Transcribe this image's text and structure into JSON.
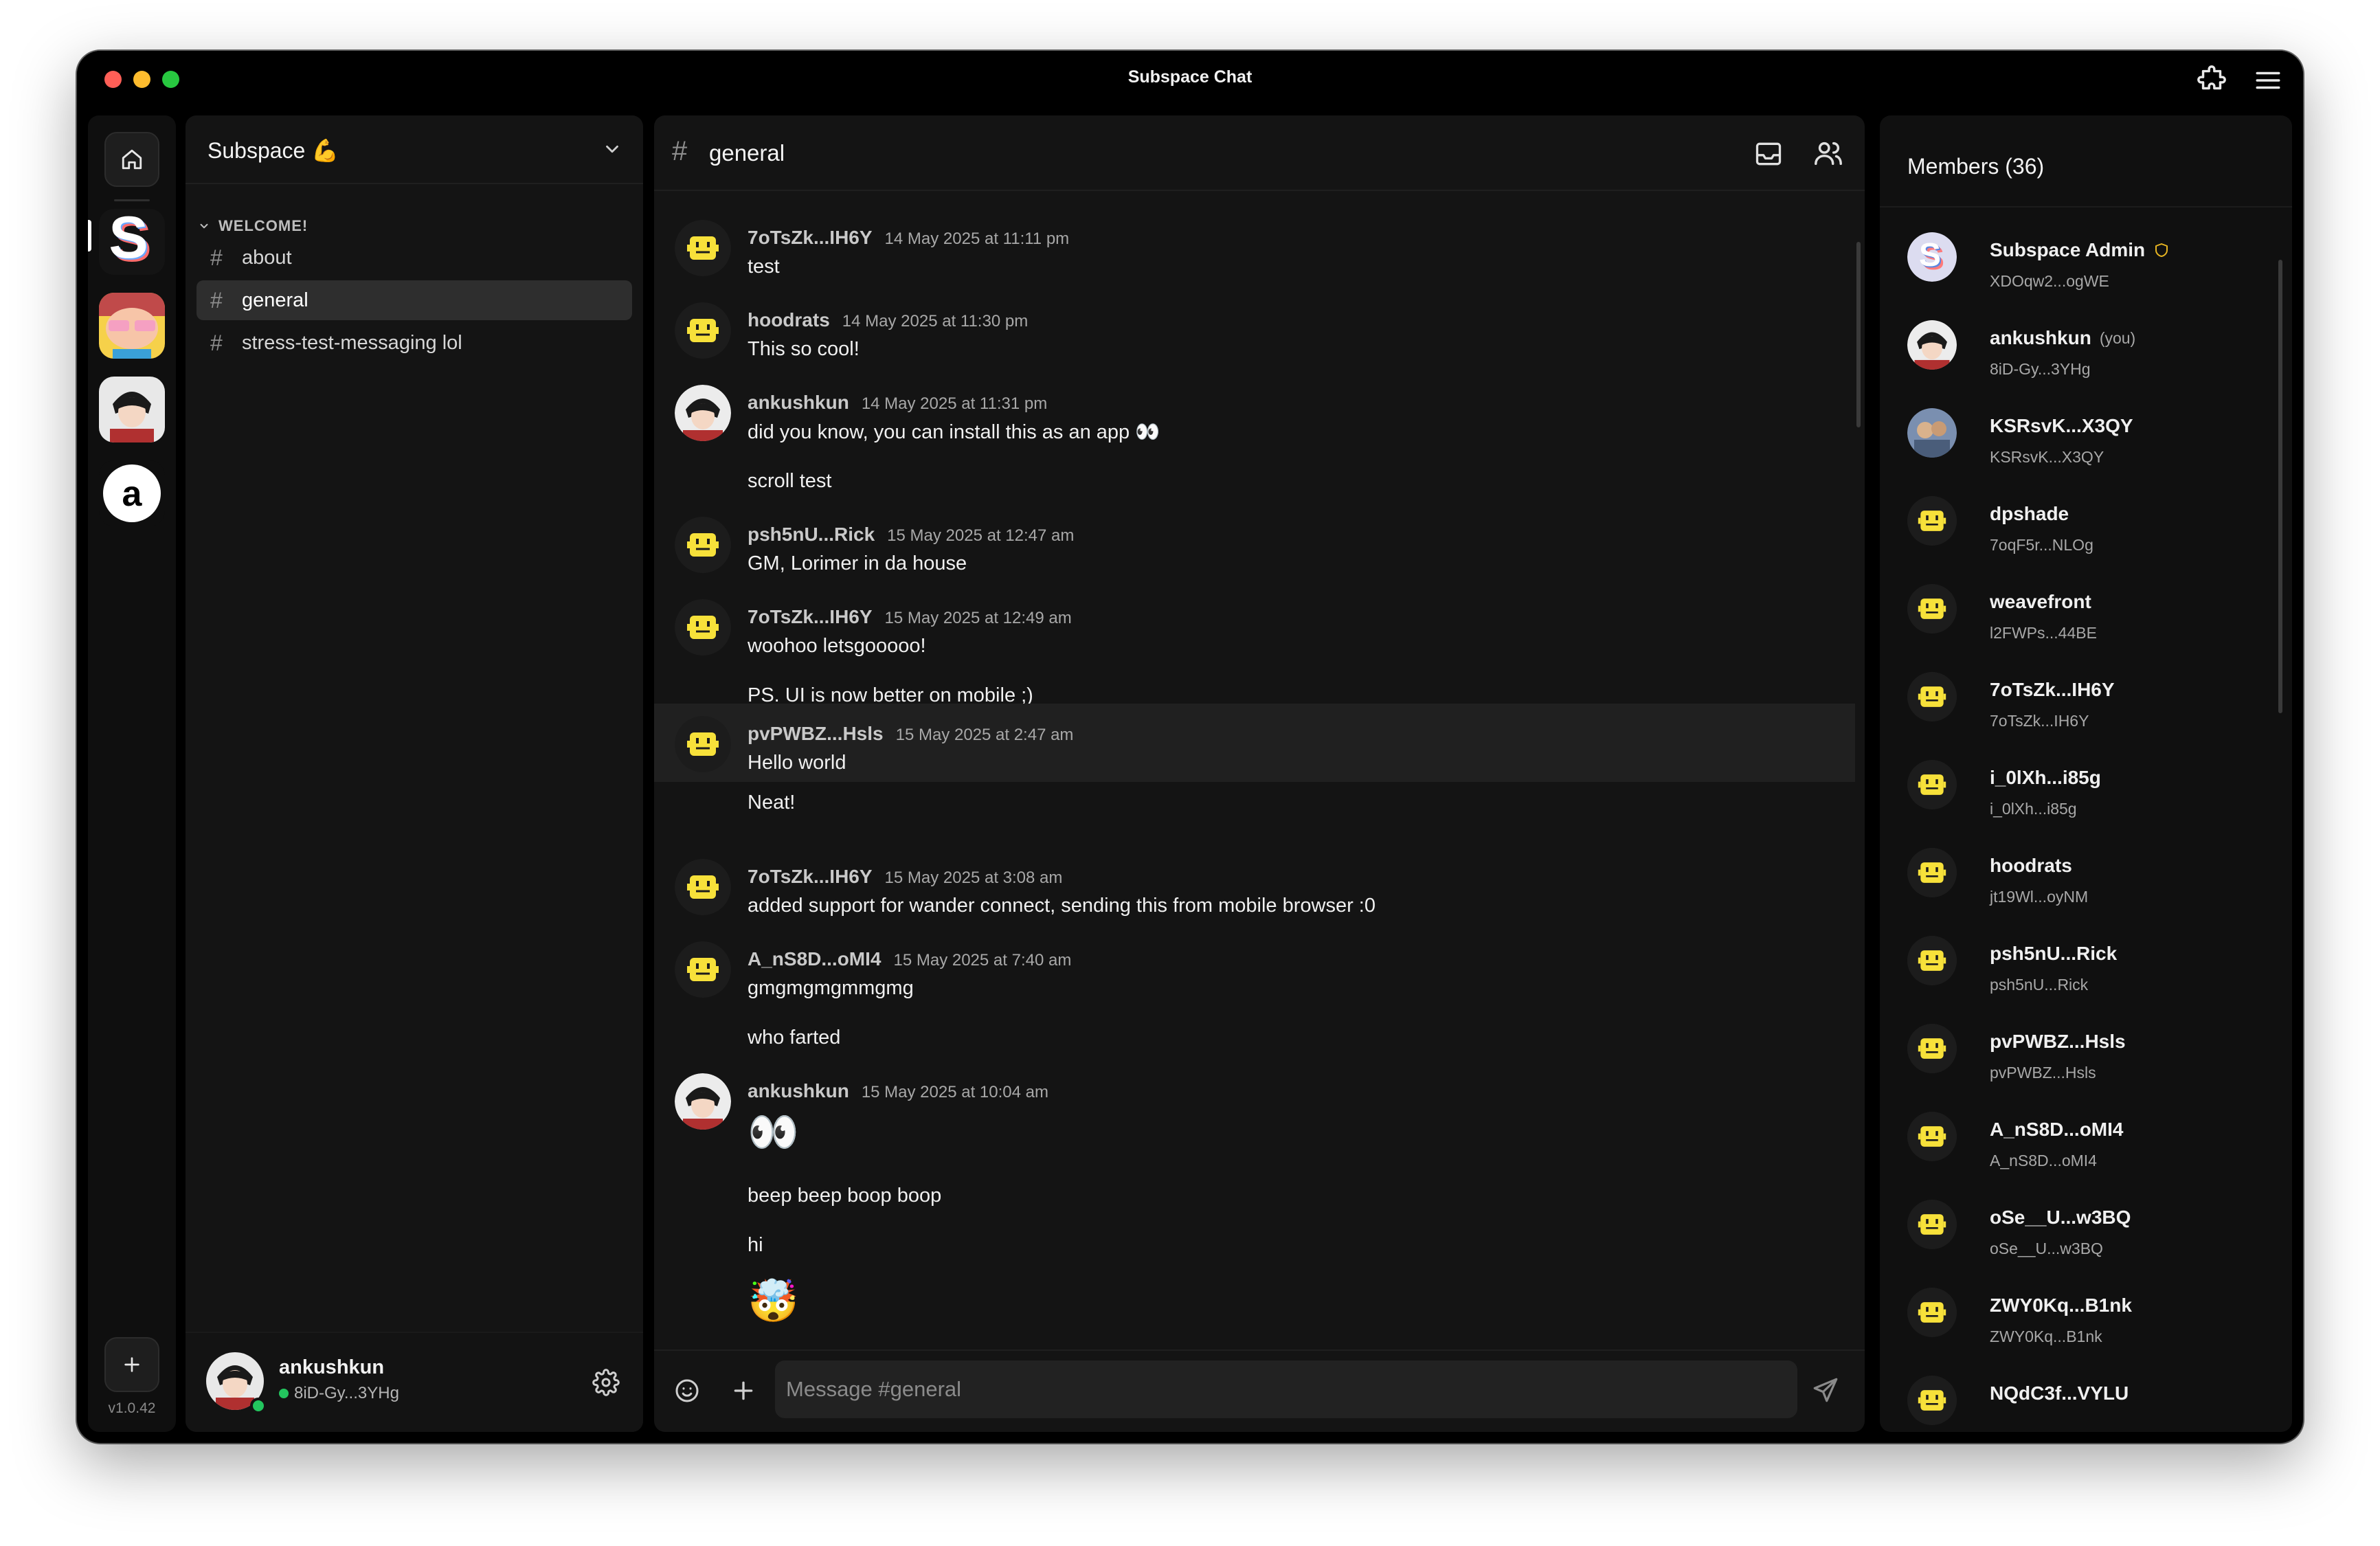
{
  "window": {
    "title": "Subspace Chat"
  },
  "rail": {
    "version": "v1.0.42"
  },
  "server": {
    "name": "Subspace 💪",
    "category": "WELCOME!",
    "channels": [
      {
        "label": "about",
        "active": false
      },
      {
        "label": "general",
        "active": true
      },
      {
        "label": "stress-test-messaging lol",
        "active": false
      }
    ]
  },
  "current_user": {
    "name": "ankushkun",
    "id": "8iD-Gy...3YHg",
    "status_color": "#23c55e"
  },
  "chat": {
    "channel": "general",
    "composer_placeholder": "Message #general",
    "messages": [
      {
        "author": "7oTsZk...IH6Y",
        "time": "14 May 2025 at 11:11 pm",
        "lines": [
          "test"
        ],
        "avatar": "bot-icon"
      },
      {
        "author": "hoodrats",
        "time": "14 May 2025 at 11:30 pm",
        "lines": [
          "This so cool!"
        ],
        "avatar": "bot-icon"
      },
      {
        "author": "ankushkun",
        "time": "14 May 2025 at 11:31 pm",
        "lines": [
          "did you know, you can install this as an app 👀",
          "scroll test"
        ],
        "avatar": "anime-avatar"
      },
      {
        "author": "psh5nU...Rick",
        "time": "15 May 2025 at 12:47 am",
        "lines": [
          "GM, Lorimer in da house"
        ],
        "avatar": "bot-icon"
      },
      {
        "author": "7oTsZk...IH6Y",
        "time": "15 May 2025 at 12:49 am",
        "lines": [
          "woohoo letsgooooo!",
          "PS. UI is now better on mobile ;)"
        ],
        "avatar": "bot-icon"
      },
      {
        "author": "pvPWBZ...Hsls",
        "time": "15 May 2025 at 2:47 am",
        "lines": [
          "Hello world",
          "Neat!"
        ],
        "avatar": "bot-icon"
      },
      {
        "author": "7oTsZk...IH6Y",
        "time": "15 May 2025 at 3:08 am",
        "lines": [
          "added support for wander connect, sending this from mobile browser :0"
        ],
        "avatar": "bot-icon"
      },
      {
        "author": "A_nS8D...oMI4",
        "time": "15 May 2025 at 7:40 am",
        "lines": [
          "gmgmgmgmmgmg",
          "who farted"
        ],
        "avatar": "bot-icon"
      },
      {
        "author": "ankushkun",
        "time": "15 May 2025 at 10:04 am",
        "lines": [
          "👀",
          "beep beep boop boop",
          "hi",
          "🤯"
        ],
        "avatar": "anime-avatar"
      }
    ]
  },
  "members": {
    "title": "Members (36)",
    "you_label": "(you)",
    "list": [
      {
        "name": "Subspace Admin",
        "id": "XDOqw2...ogWE",
        "avatar": "subspace-logo",
        "badge": "admin-shield-icon"
      },
      {
        "name": "ankushkun",
        "id": "8iD-Gy...3YHg",
        "avatar": "anime-avatar",
        "you": true
      },
      {
        "name": "KSRsvK...X3QY",
        "id": "KSRsvK...X3QY",
        "avatar": "photo-avatar"
      },
      {
        "name": "dpshade",
        "id": "7oqF5r...NLOg",
        "avatar": "bot-icon"
      },
      {
        "name": "weavefront",
        "id": "l2FWPs...44BE",
        "avatar": "bot-icon"
      },
      {
        "name": "7oTsZk...IH6Y",
        "id": "7oTsZk...IH6Y",
        "avatar": "bot-icon"
      },
      {
        "name": "i_0lXh...i85g",
        "id": "i_0lXh...i85g",
        "avatar": "bot-icon"
      },
      {
        "name": "hoodrats",
        "id": "jt19Wl...oyNM",
        "avatar": "bot-icon"
      },
      {
        "name": "psh5nU...Rick",
        "id": "psh5nU...Rick",
        "avatar": "bot-icon"
      },
      {
        "name": "pvPWBZ...Hsls",
        "id": "pvPWBZ...Hsls",
        "avatar": "bot-icon"
      },
      {
        "name": "A_nS8D...oMI4",
        "id": "A_nS8D...oMI4",
        "avatar": "bot-icon"
      },
      {
        "name": "oSe__U...w3BQ",
        "id": "oSe__U...w3BQ",
        "avatar": "bot-icon"
      },
      {
        "name": "ZWY0Kq...B1nk",
        "id": "ZWY0Kq...B1nk",
        "avatar": "bot-icon"
      },
      {
        "name": "NQdC3f...VYLU",
        "id": "",
        "avatar": "bot-icon"
      }
    ]
  },
  "colors": {
    "accent_yellow": "#f7e13a",
    "online_green": "#23c55e",
    "admin_badge": "#e6b422"
  }
}
